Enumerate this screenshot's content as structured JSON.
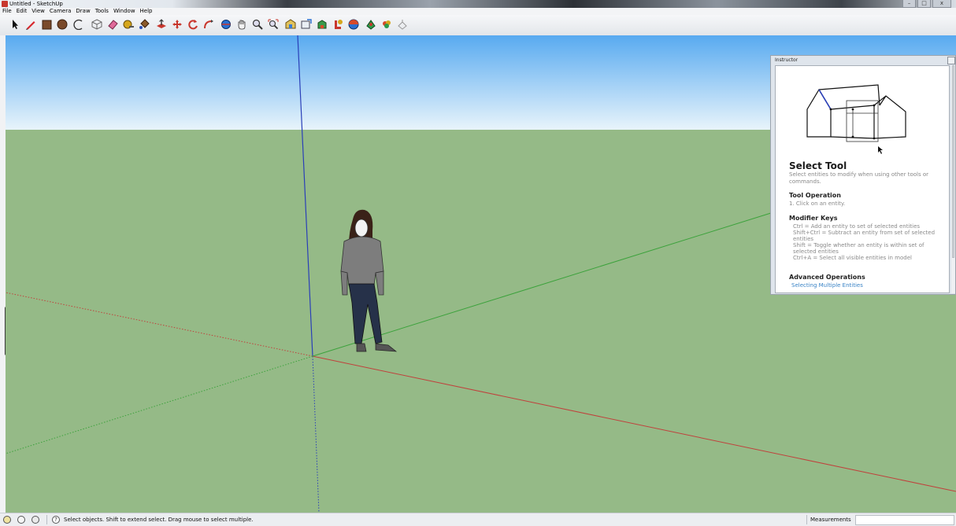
{
  "window": {
    "title": "Untitled - SketchUp",
    "controls": [
      "–",
      "□",
      "x"
    ]
  },
  "menubar": {
    "items": [
      "File",
      "Edit",
      "View",
      "Camera",
      "Draw",
      "Tools",
      "Window",
      "Help"
    ]
  },
  "toolbar": {
    "tools": [
      "select-tool-icon",
      "pencil-line-icon",
      "rectangle-icon",
      "circle-icon",
      "arc-icon",
      "make-component-icon",
      "eraser-icon",
      "tape-measure-icon",
      "paint-bucket-icon",
      "push-pull-icon",
      "move-icon",
      "rotate-icon",
      "follow-me-icon",
      "orbit-icon",
      "pan-icon",
      "zoom-icon",
      "zoom-extents-icon",
      "3d-warehouse-icon",
      "share-model-icon",
      "extension-warehouse-icon",
      "layout-icon",
      "styles-icon",
      "component-icon",
      "materials-icon",
      "add-location-icon"
    ]
  },
  "instructor": {
    "panel_title": "Instructor",
    "tool_title": "Select Tool",
    "tool_desc": "Select entities to modify when using other tools or commands.",
    "operation_heading": "Tool Operation",
    "operation_lines": [
      "1.   Click on an entity."
    ],
    "modifier_heading": "Modifier Keys",
    "modifier_lines": [
      "Ctrl = Add an entity to set of selected entities",
      "Shift+Ctrl = Subtract an entity from set of selected entities",
      "Shift = Toggle whether an entity is within set of selected entities",
      "Ctrl+A = Select all visible entities in model"
    ],
    "advanced_heading": "Advanced Operations",
    "advanced_link": "Selecting Multiple Entities"
  },
  "statusbar": {
    "message": "Select objects. Shift to extend select. Drag mouse to select multiple.",
    "measurements_label": "Measurements",
    "measurements_value": ""
  },
  "colors": {
    "sky_top": "#58aaf0",
    "sky_bottom": "#e8f4fb",
    "ground": "#95ba87",
    "axis_red": "#c0413c",
    "axis_green": "#3ca23c",
    "axis_blue": "#2a3fb8",
    "link": "#3b84c6"
  }
}
